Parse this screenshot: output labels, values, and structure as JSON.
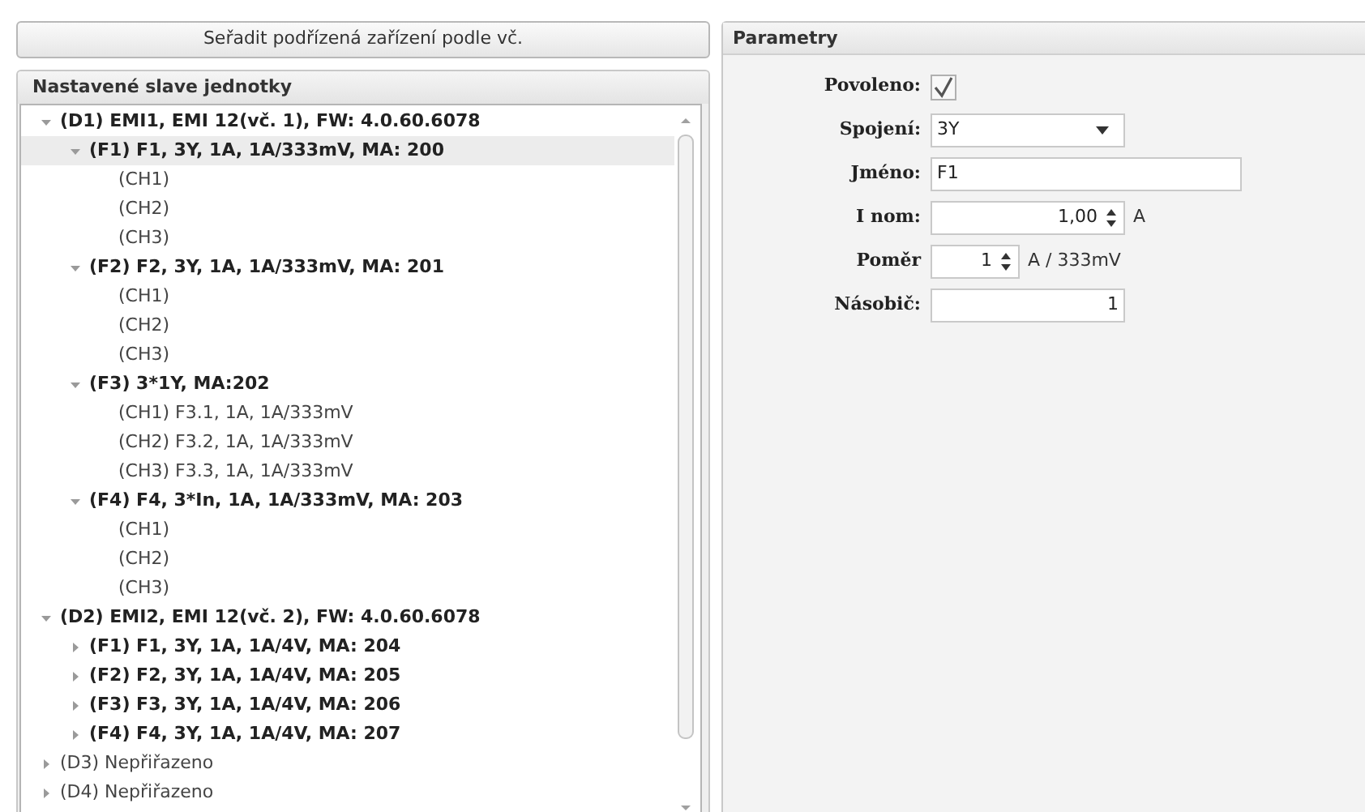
{
  "sort_button": "Seřadit podřízená zařízení podle vč.",
  "tree_panel": {
    "title": "Nastavené slave jednotky",
    "items": [
      {
        "kind": "device",
        "label": "(D1) EMI1, EMI 12(vč. 1), FW: 4.0.60.6078",
        "expanded": true,
        "selected": false,
        "children": [
          {
            "kind": "feeder",
            "label": "(F1) F1, 3Y, 1A, 1A/333mV, MA: 200",
            "expanded": true,
            "selected": true,
            "children": [
              {
                "kind": "channel",
                "label": "(CH1)",
                "selected": false
              },
              {
                "kind": "channel",
                "label": "(CH2)",
                "selected": false
              },
              {
                "kind": "channel",
                "label": "(CH3)",
                "selected": false
              }
            ]
          },
          {
            "kind": "feeder",
            "label": "(F2) F2, 3Y, 1A, 1A/333mV, MA: 201",
            "expanded": true,
            "selected": false,
            "children": [
              {
                "kind": "channel",
                "label": "(CH1)",
                "selected": false
              },
              {
                "kind": "channel",
                "label": "(CH2)",
                "selected": false
              },
              {
                "kind": "channel",
                "label": "(CH3)",
                "selected": false
              }
            ]
          },
          {
            "kind": "feeder",
            "label": "(F3) 3*1Y, MA:202",
            "expanded": true,
            "selected": false,
            "children": [
              {
                "kind": "channel",
                "label": "(CH1) F3.1, 1A, 1A/333mV",
                "selected": false
              },
              {
                "kind": "channel",
                "label": "(CH2) F3.2, 1A, 1A/333mV",
                "selected": false
              },
              {
                "kind": "channel",
                "label": "(CH3) F3.3, 1A, 1A/333mV",
                "selected": false
              }
            ]
          },
          {
            "kind": "feeder",
            "label": "(F4) F4, 3*In, 1A, 1A/333mV, MA: 203",
            "expanded": true,
            "selected": false,
            "children": [
              {
                "kind": "channel",
                "label": "(CH1)",
                "selected": false
              },
              {
                "kind": "channel",
                "label": "(CH2)",
                "selected": false
              },
              {
                "kind": "channel",
                "label": "(CH3)",
                "selected": false
              }
            ]
          }
        ]
      },
      {
        "kind": "device",
        "label": "(D2) EMI2, EMI 12(vč. 2), FW: 4.0.60.6078",
        "expanded": true,
        "selected": false,
        "children": [
          {
            "kind": "feeder",
            "label": "(F1) F1, 3Y, 1A, 1A/4V, MA: 204",
            "expanded": false,
            "selected": false
          },
          {
            "kind": "feeder",
            "label": "(F2) F2, 3Y, 1A, 1A/4V, MA: 205",
            "expanded": false,
            "selected": false
          },
          {
            "kind": "feeder",
            "label": "(F3) F3, 3Y, 1A, 1A/4V, MA: 206",
            "expanded": false,
            "selected": false
          },
          {
            "kind": "feeder",
            "label": "(F4) F4, 3Y, 1A, 1A/4V, MA: 207",
            "expanded": false,
            "selected": false
          }
        ]
      },
      {
        "kind": "empty",
        "label": "(D3) Nepřiřazeno",
        "expanded": false,
        "selected": false
      },
      {
        "kind": "empty",
        "label": "(D4) Nepřiřazeno",
        "expanded": false,
        "selected": false
      }
    ]
  },
  "params_panel": {
    "title": "Parametry",
    "fields": [
      {
        "kind": "checkbox",
        "label": "Povoleno:",
        "checked": true
      },
      {
        "kind": "dropdown",
        "label": "Spojení:",
        "value": "3Y"
      },
      {
        "kind": "text",
        "label": "Jméno:",
        "value": "F1"
      },
      {
        "kind": "spinner",
        "label": "I nom:",
        "value": "1,00",
        "unit": "A"
      },
      {
        "kind": "small_spinner",
        "label": "Poměr",
        "value": "1",
        "unit": "A / 333mV"
      },
      {
        "kind": "number",
        "label": "Násobič:",
        "value": "1"
      }
    ]
  }
}
